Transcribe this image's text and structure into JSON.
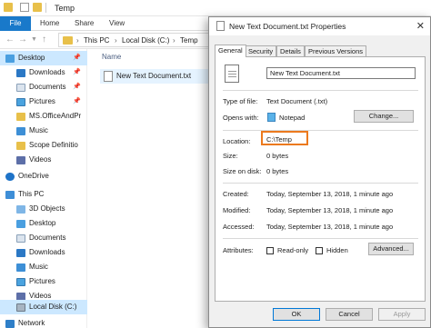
{
  "explorer": {
    "title": "Temp",
    "ribbon_tabs": [
      "File",
      "Home",
      "Share",
      "View"
    ],
    "breadcrumb": [
      "This PC",
      "Local Disk (C:)",
      "Temp"
    ],
    "column_header": "Name",
    "files": [
      {
        "name": "New Text Document.txt"
      }
    ],
    "nav_items": [
      {
        "label": "Desktop",
        "icon": "desktop-icon",
        "pinned": true,
        "selected": true
      },
      {
        "label": "Downloads",
        "icon": "downloads-icon",
        "pinned": true
      },
      {
        "label": "Documents",
        "icon": "documents-icon",
        "pinned": true
      },
      {
        "label": "Pictures",
        "icon": "pictures-icon",
        "pinned": true
      },
      {
        "label": "MS.OfficeAndPr",
        "icon": "folder-icon"
      },
      {
        "label": "Music",
        "icon": "music-icon"
      },
      {
        "label": "Scope Definitio",
        "icon": "folder-icon"
      },
      {
        "label": "Videos",
        "icon": "videos-icon"
      },
      {
        "label": "OneDrive",
        "icon": "onedrive-icon"
      },
      {
        "label": "This PC",
        "icon": "this-pc-icon"
      },
      {
        "label": "3D Objects",
        "icon": "3d-objects-icon"
      },
      {
        "label": "Desktop",
        "icon": "desktop-icon"
      },
      {
        "label": "Documents",
        "icon": "documents-icon"
      },
      {
        "label": "Downloads",
        "icon": "downloads-icon"
      },
      {
        "label": "Music",
        "icon": "music-icon"
      },
      {
        "label": "Pictures",
        "icon": "pictures-icon"
      },
      {
        "label": "Videos",
        "icon": "videos-icon"
      },
      {
        "label": "Local Disk (C:)",
        "icon": "local-disk-icon",
        "selected": true
      },
      {
        "label": "Network",
        "icon": "network-icon"
      }
    ]
  },
  "dialog": {
    "title": "New Text Document.txt Properties",
    "tabs": [
      "General",
      "Security",
      "Details",
      "Previous Versions"
    ],
    "active_tab": "General",
    "filename": "New Text Document.txt",
    "type_label": "Type of file:",
    "type_value": "Text Document (.txt)",
    "opens_label": "Opens with:",
    "opens_value": "Notepad",
    "change_button": "Change...",
    "location_label": "Location:",
    "location_value": "C:\\Temp",
    "size_label": "Size:",
    "size_value": "0 bytes",
    "size_disk_label": "Size on disk:",
    "size_disk_value": "0 bytes",
    "created_label": "Created:",
    "created_value": "Today, September 13, 2018, 1 minute ago",
    "modified_label": "Modified:",
    "modified_value": "Today, September 13, 2018, 1 minute ago",
    "accessed_label": "Accessed:",
    "accessed_value": "Today, September 13, 2018, 1 minute ago",
    "attributes_label": "Attributes:",
    "readonly_label": "Read-only",
    "hidden_label": "Hidden",
    "advanced_button": "Advanced...",
    "ok_button": "OK",
    "cancel_button": "Cancel",
    "apply_button": "Apply"
  },
  "colors": {
    "accent": "#1979ca",
    "selection": "#cce8ff",
    "highlight_box": "#ec7a1e"
  }
}
